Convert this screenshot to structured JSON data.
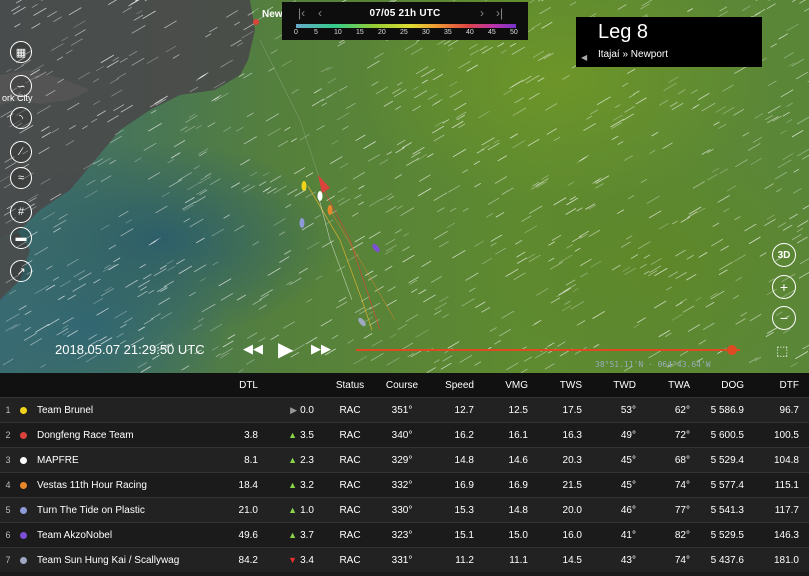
{
  "timebar": {
    "time_label": "07/05 21h UTC",
    "wind_scale": [
      "0",
      "5",
      "10",
      "15",
      "20",
      "25",
      "30",
      "35",
      "40",
      "45",
      "50"
    ]
  },
  "leg": {
    "title": "Leg 8",
    "route": "Itajaí » Newport"
  },
  "places": {
    "newport": "New",
    "new_york": "ork City"
  },
  "playback": {
    "clock": "2018.05.07 21:29:50 UTC",
    "progress": 0.98,
    "coords": "38°51.11'N · 064°43.64'W"
  },
  "table": {
    "headers": {
      "dtl": "DTL",
      "status": "Status",
      "course": "Course",
      "speed": "Speed",
      "vmg": "VMG",
      "tws": "TWS",
      "twd": "TWD",
      "twa": "TWA",
      "dog": "DOG",
      "dtf": "DTF"
    },
    "rows": [
      {
        "rank": "1",
        "color": "#f2d41a",
        "name": "Team Brunel",
        "dtl": "",
        "trend": "flat",
        "delta": "0.0",
        "status": "RAC",
        "course": "351°",
        "speed": "12.7",
        "vmg": "12.5",
        "tws": "17.5",
        "twd": "53°",
        "twa": "62°",
        "dog": "5 586.9",
        "dtf": "96.7"
      },
      {
        "rank": "2",
        "color": "#d9433b",
        "name": "Dongfeng Race Team",
        "dtl": "3.8",
        "trend": "up",
        "delta": "3.5",
        "status": "RAC",
        "course": "340°",
        "speed": "16.2",
        "vmg": "16.1",
        "tws": "16.3",
        "twd": "49°",
        "twa": "72°",
        "dog": "5 600.5",
        "dtf": "100.5"
      },
      {
        "rank": "3",
        "color": "#ffffff",
        "name": "MAPFRE",
        "dtl": "8.1",
        "trend": "up",
        "delta": "2.3",
        "status": "RAC",
        "course": "329°",
        "speed": "14.8",
        "vmg": "14.6",
        "tws": "20.3",
        "twd": "45°",
        "twa": "68°",
        "dog": "5 529.4",
        "dtf": "104.8"
      },
      {
        "rank": "4",
        "color": "#e8872a",
        "name": "Vestas 11th Hour Racing",
        "dtl": "18.4",
        "trend": "up",
        "delta": "3.2",
        "status": "RAC",
        "course": "332°",
        "speed": "16.9",
        "vmg": "16.9",
        "tws": "21.5",
        "twd": "45°",
        "twa": "74°",
        "dog": "5 577.4",
        "dtf": "115.1"
      },
      {
        "rank": "5",
        "color": "#8f9ad9",
        "name": "Turn The Tide on Plastic",
        "dtl": "21.0",
        "trend": "up",
        "delta": "1.0",
        "status": "RAC",
        "course": "330°",
        "speed": "15.3",
        "vmg": "14.8",
        "tws": "20.0",
        "twd": "46°",
        "twa": "77°",
        "dog": "5 541.3",
        "dtf": "117.7"
      },
      {
        "rank": "6",
        "color": "#7b4fd6",
        "name": "Team AkzoNobel",
        "dtl": "49.6",
        "trend": "up",
        "delta": "3.7",
        "status": "RAC",
        "course": "323°",
        "speed": "15.1",
        "vmg": "15.0",
        "tws": "16.0",
        "twd": "41°",
        "twa": "82°",
        "dog": "5 529.5",
        "dtf": "146.3"
      },
      {
        "rank": "7",
        "color": "#9fa8c2",
        "name": "Team Sun Hung Kai / Scallywag",
        "dtl": "84.2",
        "trend": "down",
        "delta": "3.4",
        "status": "RAC",
        "course": "331°",
        "speed": "11.2",
        "vmg": "11.1",
        "tws": "14.5",
        "twd": "43°",
        "twa": "74°",
        "dog": "5 437.6",
        "dtf": "181.0"
      }
    ]
  }
}
